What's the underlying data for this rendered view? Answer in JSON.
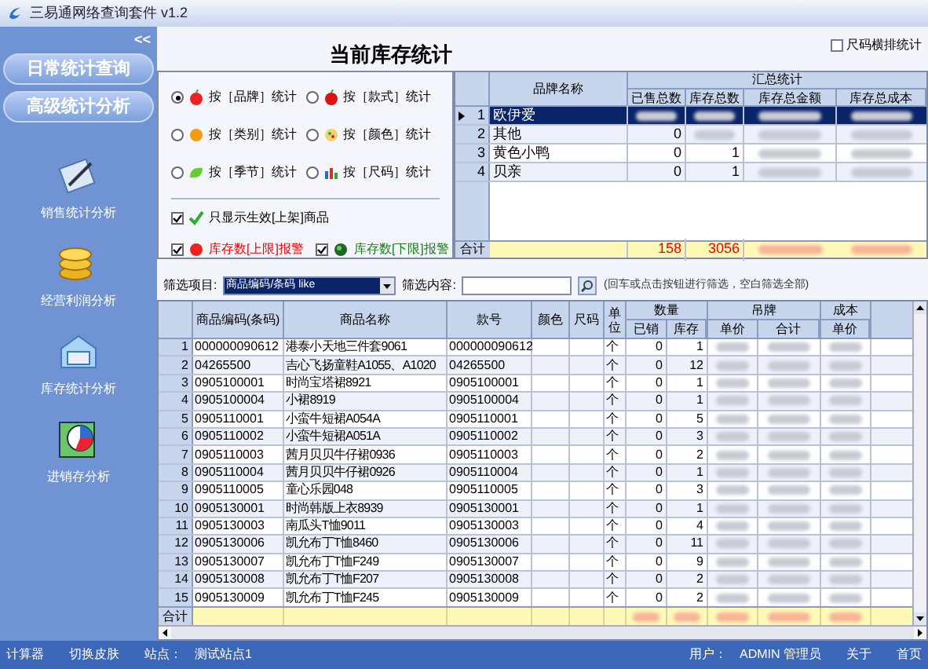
{
  "window": {
    "title": "三易通网络查询套件 v1.2"
  },
  "sidebar": {
    "collapse": "<<",
    "sections": [
      "日常统计查询",
      "高级统计分析"
    ],
    "items": [
      {
        "kind": "sales",
        "label": "销售统计分析"
      },
      {
        "kind": "profit",
        "label": "经营利润分析"
      },
      {
        "kind": "stock",
        "label": "库存统计分析"
      },
      {
        "kind": "flow",
        "label": "进销存分析"
      }
    ]
  },
  "header": {
    "title": "当前库存统计",
    "size_option": {
      "label": "尺码横排统计",
      "checked": false
    }
  },
  "options": {
    "radios": [
      {
        "kind": "brand",
        "label": "按［品牌］统计",
        "selected": true
      },
      {
        "kind": "style",
        "label": "按［款式］统计",
        "selected": false
      },
      {
        "kind": "category",
        "label": "按［类别］统计",
        "selected": false
      },
      {
        "kind": "color",
        "label": "按［颜色］统计",
        "selected": false
      },
      {
        "kind": "season",
        "label": "按［季节］统计",
        "selected": false
      },
      {
        "kind": "size",
        "label": "按［尺码］统计",
        "selected": false
      }
    ],
    "checks": [
      {
        "kind": "active",
        "label": "只显示生效[上架]商品",
        "checked": true
      },
      {
        "kind": "upper",
        "label": "库存数[上限]报警",
        "checked": true
      },
      {
        "kind": "lower",
        "label": "库存数[下限]报警",
        "checked": true
      }
    ]
  },
  "summary_table": {
    "group": "汇总统计",
    "columns": [
      "品牌名称",
      "已售总数",
      "库存总数",
      "库存总金额",
      "库存总成本"
    ],
    "rows": [
      {
        "no": "1",
        "brand": "欧伊爱",
        "selected": true
      },
      {
        "no": "2",
        "brand": "其他",
        "sold": "0",
        "selected": false
      },
      {
        "no": "3",
        "brand": "黄色小鸭",
        "sold": "0",
        "stock": "1",
        "selected": false
      },
      {
        "no": "4",
        "brand": "贝亲",
        "sold": "0",
        "stock": "1",
        "selected": false
      }
    ],
    "total": {
      "label": "合计",
      "sold": "158",
      "stock": "3056"
    }
  },
  "filter": {
    "item_label": "筛选项目:",
    "item_value": "商品编码/条码 like",
    "content_label": "筛选内容:",
    "hint": "(回车或点击按钮进行筛选，空白筛选全部)"
  },
  "detail_table": {
    "columns": [
      "商品编码(条码)",
      "商品名称",
      "款号",
      "颜色",
      "尺码",
      "单位"
    ],
    "groups": [
      {
        "label": "数量",
        "sub": [
          "已销",
          "库存"
        ]
      },
      {
        "label": "吊牌",
        "sub": [
          "单价",
          "合计"
        ]
      },
      {
        "label": "成本",
        "sub": [
          "单价"
        ]
      }
    ],
    "rows": [
      {
        "no": "1",
        "code": "000000090612",
        "name": "港泰小天地三件套9061",
        "style": "000000090612",
        "unit": "个",
        "sold": "0",
        "stock": "1"
      },
      {
        "no": "2",
        "code": "04265500",
        "name": "吉心飞扬童鞋A1055、A1020",
        "style": "04265500",
        "unit": "个",
        "sold": "0",
        "stock": "12"
      },
      {
        "no": "3",
        "code": "0905100001",
        "name": "时尚宝塔裙8921",
        "style": "0905100001",
        "unit": "个",
        "sold": "0",
        "stock": "1"
      },
      {
        "no": "4",
        "code": "0905100004",
        "name": "小裙8919",
        "style": "0905100004",
        "unit": "个",
        "sold": "0",
        "stock": "1"
      },
      {
        "no": "5",
        "code": "0905110001",
        "name": "小蛮牛短裙A054A",
        "style": "0905110001",
        "unit": "个",
        "sold": "0",
        "stock": "5"
      },
      {
        "no": "6",
        "code": "0905110002",
        "name": "小蛮牛短裙A051A",
        "style": "0905110002",
        "unit": "个",
        "sold": "0",
        "stock": "3"
      },
      {
        "no": "7",
        "code": "0905110003",
        "name": "茜月贝贝牛仔裙0936",
        "style": "0905110003",
        "unit": "个",
        "sold": "0",
        "stock": "2"
      },
      {
        "no": "8",
        "code": "0905110004",
        "name": "茜月贝贝牛仔裙0926",
        "style": "0905110004",
        "unit": "个",
        "sold": "0",
        "stock": "1"
      },
      {
        "no": "9",
        "code": "0905110005",
        "name": "童心乐园048",
        "style": "0905110005",
        "unit": "个",
        "sold": "0",
        "stock": "3"
      },
      {
        "no": "10",
        "code": "0905130001",
        "name": "时尚韩版上衣8939",
        "style": "0905130001",
        "unit": "个",
        "sold": "0",
        "stock": "1"
      },
      {
        "no": "11",
        "code": "0905130003",
        "name": "南瓜头T恤9011",
        "style": "0905130003",
        "unit": "个",
        "sold": "0",
        "stock": "4"
      },
      {
        "no": "12",
        "code": "0905130006",
        "name": "凯允布丁T恤8460",
        "style": "0905130006",
        "unit": "个",
        "sold": "0",
        "stock": "11"
      },
      {
        "no": "13",
        "code": "0905130007",
        "name": "凯允布丁T恤F249",
        "style": "0905130007",
        "unit": "个",
        "sold": "0",
        "stock": "9"
      },
      {
        "no": "14",
        "code": "0905130008",
        "name": "凯允布丁T恤F207",
        "style": "0905130008",
        "unit": "个",
        "sold": "0",
        "stock": "2"
      },
      {
        "no": "15",
        "code": "0905130009",
        "name": "凯允布丁T恤F245",
        "style": "0905130009",
        "unit": "个",
        "sold": "0",
        "stock": "2"
      }
    ],
    "total_label": "合计"
  },
  "status_bar": {
    "left": [
      "计算器",
      "切换皮肤"
    ],
    "site_label": "站点：",
    "site": "测试站点1",
    "user_label": "用户：",
    "user": "ADMIN 管理员",
    "right": [
      "关于",
      "首页"
    ]
  }
}
